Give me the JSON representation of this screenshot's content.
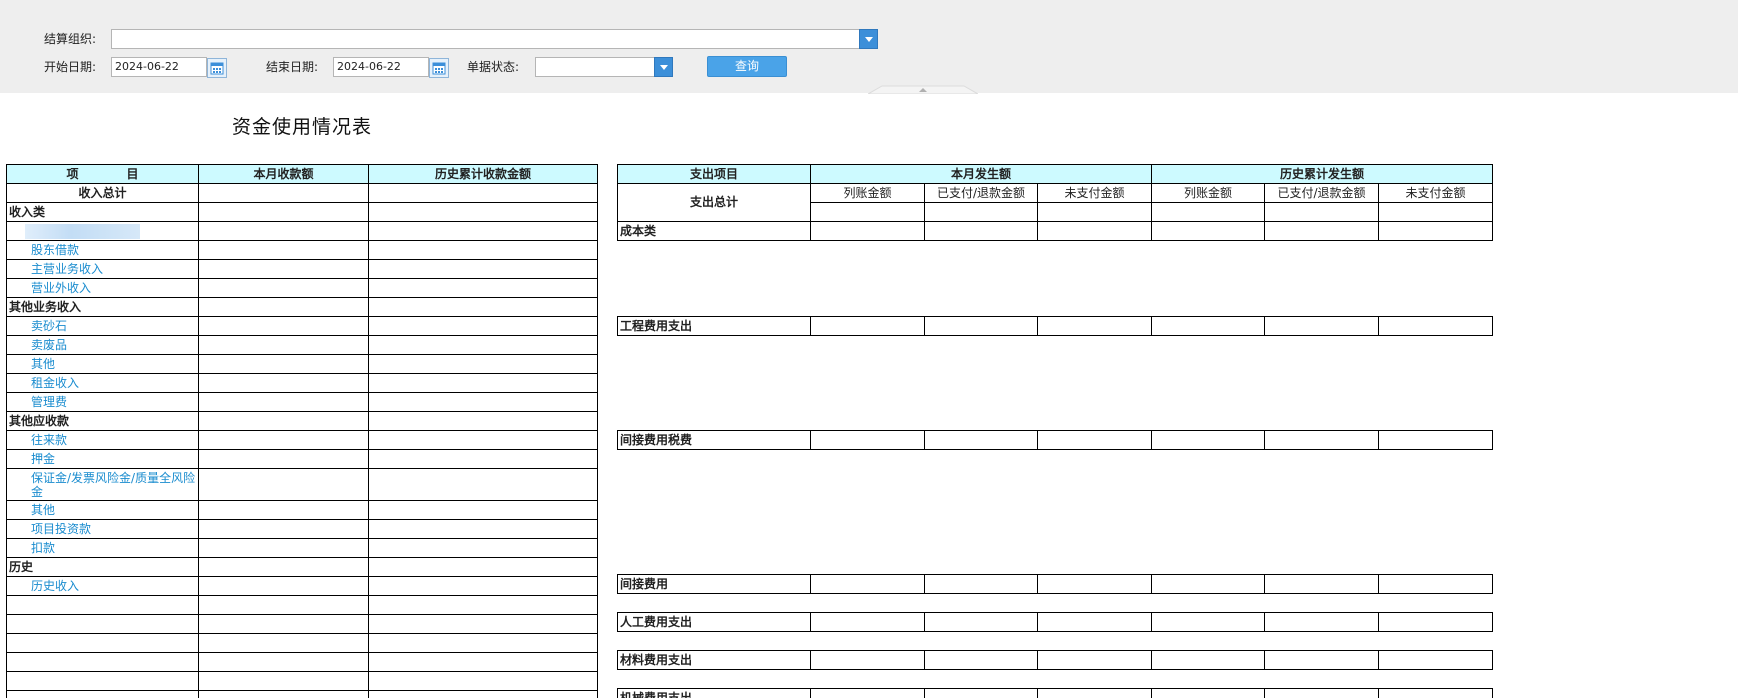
{
  "filters": {
    "org_label": "结算组织:",
    "org_value": "",
    "start_label": "开始日期:",
    "start_value": "2024-06-22",
    "end_label": "结束日期:",
    "end_value": "2024-06-22",
    "status_label": "单据状态:",
    "status_value": "",
    "query_button": "查询"
  },
  "report": {
    "title": "资金使用情况表",
    "left": {
      "headers": [
        "项　　　　目",
        "本月收款额",
        "历史累计收款金额"
      ],
      "rows": [
        {
          "label": "收入总计",
          "style": "bold-center"
        },
        {
          "label": "收入类",
          "style": "bold"
        },
        {
          "label": "",
          "style": "sub-redacted"
        },
        {
          "label": "股东借款",
          "style": "sub"
        },
        {
          "label": "主营业务收入",
          "style": "sub"
        },
        {
          "label": "营业外收入",
          "style": "sub"
        },
        {
          "label": "其他业务收入",
          "style": "bold"
        },
        {
          "label": "卖砂石",
          "style": "sub"
        },
        {
          "label": "卖废品",
          "style": "sub"
        },
        {
          "label": "其他",
          "style": "sub"
        },
        {
          "label": "租金收入",
          "style": "sub"
        },
        {
          "label": "管理费",
          "style": "sub"
        },
        {
          "label": "其他应收款",
          "style": "bold"
        },
        {
          "label": "往来款",
          "style": "sub"
        },
        {
          "label": "押金",
          "style": "sub"
        },
        {
          "label": "保证金/发票风险金/质量全风险金",
          "style": "sub-wrap"
        },
        {
          "label": "其他",
          "style": "sub"
        },
        {
          "label": "项目投资款",
          "style": "sub"
        },
        {
          "label": "扣款",
          "style": "sub"
        },
        {
          "label": "历史",
          "style": "bold"
        },
        {
          "label": "历史收入",
          "style": "sub"
        },
        {
          "label": "",
          "style": "blank"
        },
        {
          "label": "",
          "style": "blank"
        },
        {
          "label": "",
          "style": "blank"
        },
        {
          "label": "",
          "style": "blank"
        },
        {
          "label": "",
          "style": "blank"
        },
        {
          "label": "",
          "style": "blank"
        }
      ]
    },
    "right": {
      "header_item": "支出项目",
      "header_month": "本月发生额",
      "header_history": "历史累计发生额",
      "sub_headers": [
        "列账金额",
        "已支付/退款金额",
        "未支付金额",
        "列账金额",
        "已支付/退款金额",
        "未支付金额"
      ],
      "total_label": "支出总计",
      "sections": [
        "成本类",
        "工程费用支出",
        "间接费用税费",
        "间接费用",
        "人工费用支出",
        "材料费用支出",
        "机械费用支出"
      ]
    }
  }
}
